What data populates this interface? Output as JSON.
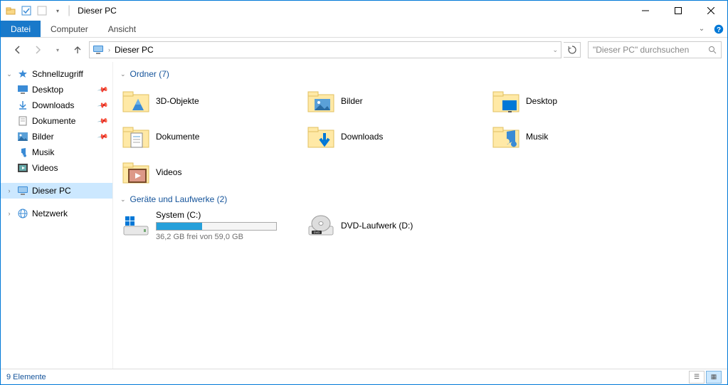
{
  "title": "Dieser PC",
  "ribbon": {
    "file": "Datei",
    "computer": "Computer",
    "view": "Ansicht"
  },
  "address": {
    "crumb": "Dieser PC"
  },
  "search": {
    "placeholder": "\"Dieser PC\" durchsuchen"
  },
  "sidebar": {
    "quick": "Schnellzugriff",
    "quick_items": [
      {
        "label": "Desktop"
      },
      {
        "label": "Downloads"
      },
      {
        "label": "Dokumente"
      },
      {
        "label": "Bilder"
      },
      {
        "label": "Musik"
      },
      {
        "label": "Videos"
      }
    ],
    "thispc": "Dieser PC",
    "network": "Netzwerk"
  },
  "groups": {
    "folders": {
      "label": "Ordner",
      "count": "(7)"
    },
    "devices": {
      "label": "Geräte und Laufwerke",
      "count": "(2)"
    }
  },
  "folders": [
    {
      "label": "3D-Objekte"
    },
    {
      "label": "Bilder"
    },
    {
      "label": "Desktop"
    },
    {
      "label": "Dokumente"
    },
    {
      "label": "Downloads"
    },
    {
      "label": "Musik"
    },
    {
      "label": "Videos"
    }
  ],
  "drive_c": {
    "label": "System (C:)",
    "free": "36,2 GB frei von 59,0 GB",
    "used_pct": 38
  },
  "drive_d": {
    "label": "DVD-Laufwerk (D:)"
  },
  "status": {
    "count": "9 Elemente"
  }
}
